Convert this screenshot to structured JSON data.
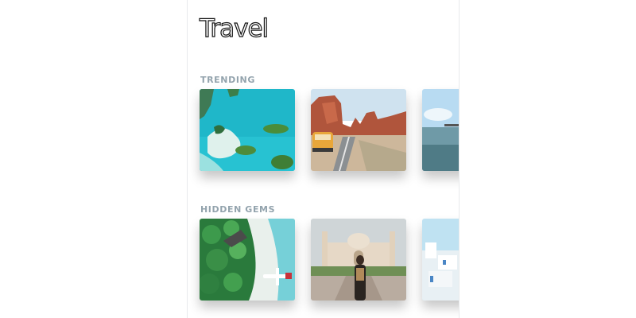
{
  "page": {
    "title": "Travel"
  },
  "sections": [
    {
      "label": "TRENDING",
      "cards": [
        {
          "name": "aerial-lagoon-islands"
        },
        {
          "name": "desert-road-van"
        },
        {
          "name": "lake-pier"
        }
      ]
    },
    {
      "label": "HIDDEN GEMS",
      "cards": [
        {
          "name": "tropical-beach-seaplane"
        },
        {
          "name": "palace-walkway"
        },
        {
          "name": "white-village-sea"
        }
      ]
    }
  ]
}
